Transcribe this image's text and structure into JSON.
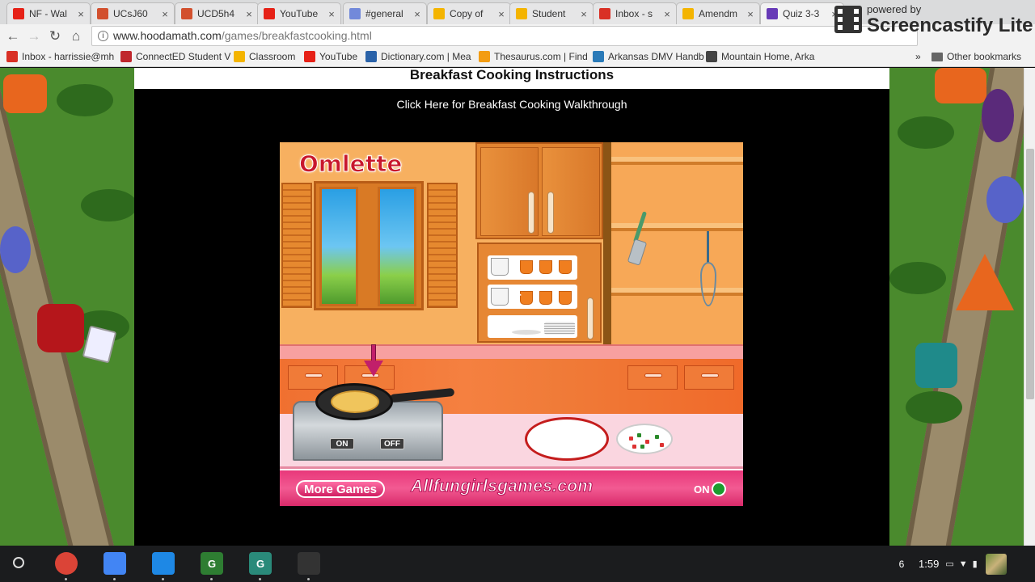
{
  "tabs": [
    {
      "title": "NF - Wal",
      "favicon": "youtube-icon",
      "color": "#e62117",
      "active": false
    },
    {
      "title": "UCsJ60",
      "favicon": "analytics-icon",
      "color": "#d2502e",
      "active": false
    },
    {
      "title": "UCD5h4",
      "favicon": "analytics-icon",
      "color": "#d2502e",
      "active": false
    },
    {
      "title": "YouTube",
      "favicon": "youtube-icon",
      "color": "#e62117",
      "active": false
    },
    {
      "title": "#general",
      "favicon": "discord-icon",
      "color": "#7289da",
      "active": false
    },
    {
      "title": "Copy of",
      "favicon": "slides-icon",
      "color": "#f4b400",
      "active": false
    },
    {
      "title": "Student",
      "favicon": "slides-icon",
      "color": "#f4b400",
      "active": false
    },
    {
      "title": "Inbox - s",
      "favicon": "gmail-icon",
      "color": "#d93025",
      "active": false
    },
    {
      "title": "Amendm",
      "favicon": "slides-icon",
      "color": "#f4b400",
      "active": false
    },
    {
      "title": "Quiz 3-3",
      "favicon": "forms-icon",
      "color": "#673ab7",
      "active": true
    }
  ],
  "close_glyph": "×",
  "toolbar": {
    "url_host": "www.hoodamath.com",
    "url_path": "/games/breakfastcooking.html"
  },
  "bookmarks": [
    {
      "label": "Inbox - harrissie@mh",
      "icon": "gmail-icon",
      "color": "#d93025"
    },
    {
      "label": "ConnectED Student V",
      "icon": "connected-icon",
      "color": "#c0272d"
    },
    {
      "label": "Classroom",
      "icon": "classroom-icon",
      "color": "#f4b400"
    },
    {
      "label": "YouTube",
      "icon": "youtube-icon",
      "color": "#e62117"
    },
    {
      "label": "Dictionary.com | Mea",
      "icon": "dictionary-icon",
      "color": "#2a62a8"
    },
    {
      "label": "Thesaurus.com | Find",
      "icon": "thesaurus-icon",
      "color": "#f39c12"
    },
    {
      "label": "Arkansas DMV Handb",
      "icon": "dmv-icon",
      "color": "#2a7ab8"
    },
    {
      "label": "Mountain Home, Arka",
      "icon": "map-pin-icon",
      "color": "#444444"
    }
  ],
  "bookmarks_overflow": "»",
  "other_bookmarks": "Other bookmarks",
  "watermark": {
    "line1": "powered by",
    "line2": "Screencastify Lite"
  },
  "page": {
    "heading": "Breakfast Cooking Instructions",
    "walkthrough_link": "Click Here for Breakfast Cooking Walkthrough"
  },
  "game": {
    "title": "Omlette",
    "stove_on": "ON",
    "stove_off": "OFF",
    "more_games": "More Games",
    "brand": "Allfungirlsgames.com",
    "sound_label": "ON"
  },
  "taskbar": {
    "apps": [
      {
        "name": "chrome-icon",
        "color": "#db4437",
        "glyph": ""
      },
      {
        "name": "docs-icon",
        "color": "#4285f4",
        "glyph": ""
      },
      {
        "name": "files-icon",
        "color": "#1e88e5",
        "glyph": ""
      },
      {
        "name": "classroom-g-icon",
        "color": "#2e7d32",
        "glyph": "G"
      },
      {
        "name": "classroom-g-icon",
        "color": "#2a8a7a",
        "glyph": "G"
      },
      {
        "name": "screencastify-icon",
        "color": "#333333",
        "glyph": ""
      }
    ],
    "notification_count": "6",
    "time": "1:59"
  }
}
